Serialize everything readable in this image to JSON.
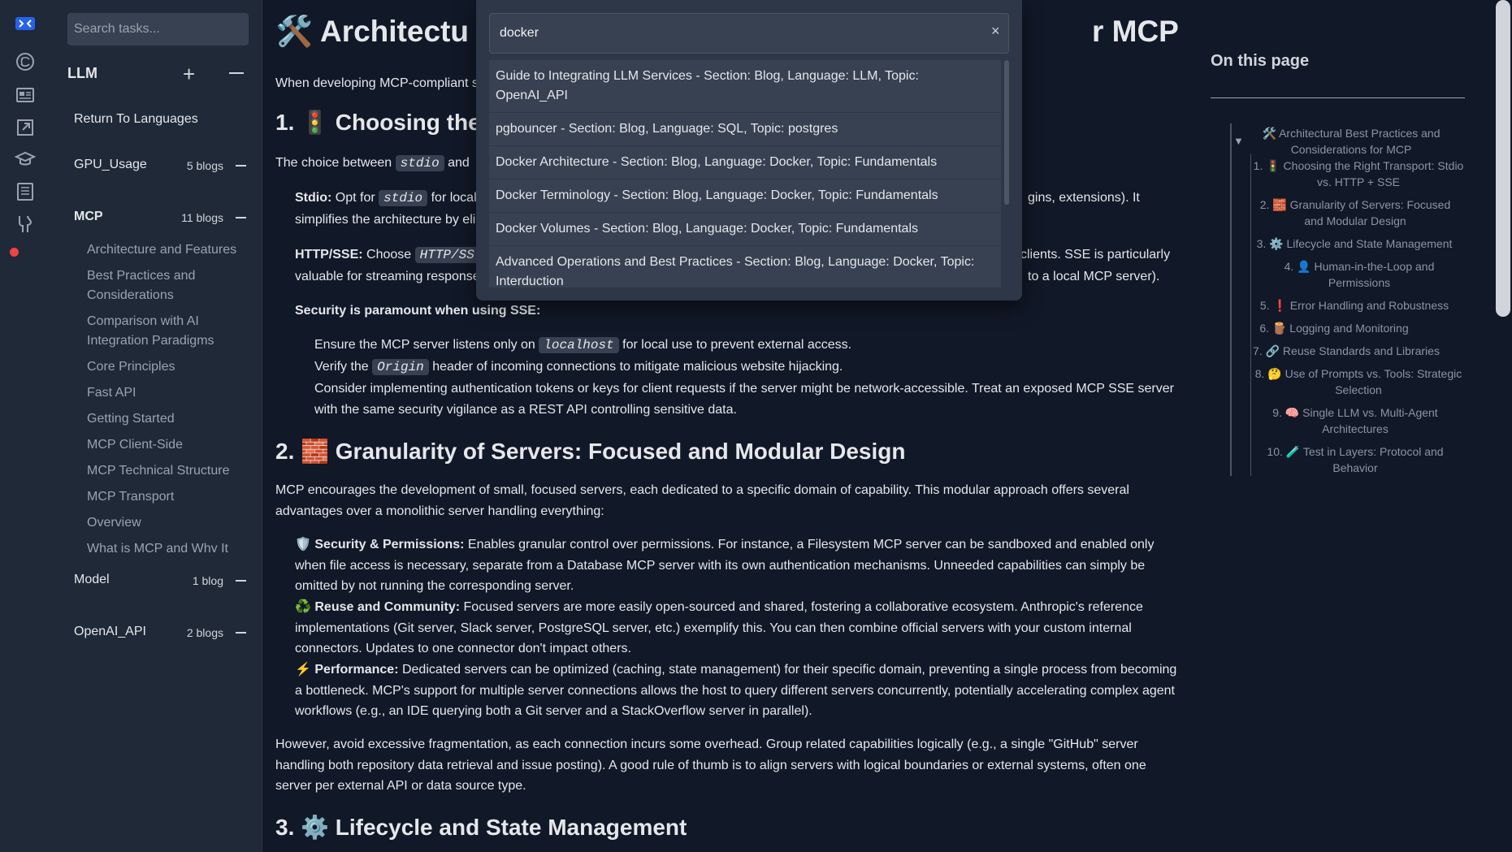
{
  "sidebar": {
    "search_placeholder": "Search tasks...",
    "title": "LLM",
    "return_label": "Return To Languages",
    "groups": [
      {
        "name": "GPU_Usage",
        "count": "5 blogs"
      },
      {
        "name": "MCP",
        "count": "11 blogs"
      },
      {
        "name": "Model",
        "count": "1 blog"
      },
      {
        "name": "OpenAI_API",
        "count": "2 blogs"
      }
    ],
    "mcp_items": [
      "Architecture and Features",
      "Best Practices and Considerations",
      "Comparison with AI Integration Paradigms",
      "Core Principles",
      "Fast API",
      "Getting Started",
      "MCP Client-Side",
      "MCP Technical Structure",
      "MCP Transport",
      "Overview",
      "What is MCP and Why It"
    ]
  },
  "search_modal": {
    "query": "docker",
    "clear": "×",
    "results": [
      "Guide to Integrating LLM Services - Section: Blog, Language: LLM, Topic: OpenAI_API",
      "pgbouncer - Section: Blog, Language: SQL, Topic: postgres",
      "Docker Architecture - Section: Blog, Language: Docker, Topic: Fundamentals",
      "Docker Terminology - Section: Blog, Language: Docker, Topic: Fundamentals",
      "Docker Volumes - Section: Blog, Language: Docker, Topic: Fundamentals",
      "Advanced Operations and Best Practices - Section: Blog, Language: Docker, Topic: Interduction",
      ""
    ]
  },
  "article": {
    "title_start": "🛠️ Architectu",
    "title_end": "r MCP",
    "intro": "When developing MCP-compliant s",
    "h2_1": "1. 🚦 Choosing the",
    "choice_a": "The choice between",
    "choice_code": "stdio",
    "choice_b": "and",
    "stdio_label": "Stdio:",
    "stdio_a": "Opt for",
    "stdio_code": "stdio",
    "stdio_b": "for local",
    "stdio_right": "gins, extensions). It",
    "stdio_line2": "simplifies the architecture by eli",
    "http_label": "HTTP/SSE:",
    "http_a": "Choose",
    "http_code": "HTTP/SS",
    "http_right": "l clients. SSE is particularly",
    "http_line2": "valuable for streaming response",
    "http_line2_right": "to a local MCP server).",
    "security_heading": "Security is paramount when using SSE:",
    "sec1_a": "Ensure the MCP server listens only on",
    "sec1_code": "localhost",
    "sec1_b": "for local use to prevent external access.",
    "sec2_a": "Verify the",
    "sec2_code": "Origin",
    "sec2_b": "header of incoming connections to mitigate malicious website hijacking.",
    "sec3": "Consider implementing authentication tokens or keys for client requests if the server might be network-accessible. Treat an exposed MCP SSE server with the same security vigilance as a REST API controlling sensitive data.",
    "h2_2": "2. 🧱 Granularity of Servers: Focused and Modular Design",
    "p2": "MCP encourages the development of small, focused servers, each dedicated to a specific domain of capability. This modular approach offers several advantages over a monolithic server handling everything:",
    "b1_label": "🛡️ Security & Permissions:",
    "b1_text": "Enables granular control over permissions. For instance, a Filesystem MCP server can be sandboxed and enabled only when file access is necessary, separate from a Database MCP server with its own authentication mechanisms. Unneeded capabilities can simply be omitted by not running the corresponding server.",
    "b2_label": "♻️ Reuse and Community:",
    "b2_text": "Focused servers are more easily open-sourced and shared, fostering a collaborative ecosystem. Anthropic's reference implementations (Git server, Slack server, PostgreSQL server, etc.) exemplify this. You can then combine official servers with your custom internal connectors. Updates to one connector don't impact others.",
    "b3_label": "⚡ Performance:",
    "b3_text": "Dedicated servers can be optimized (caching, state management) for their specific domain, preventing a single process from becoming a bottleneck. MCP's support for multiple server connections allows the host to query different servers concurrently, potentially accelerating complex agent workflows (e.g., an IDE querying both a Git server and a StackOverflow server in parallel).",
    "p3": "However, avoid excessive fragmentation, as each connection incurs some overhead. Group related capabilities logically (e.g., a single \"GitHub\" server handling both repository data retrieval and issue posting). A good rule of thumb is to align servers with logical boundaries or external systems, often one server per external API or data source type.",
    "h2_3": "3. ⚙️ Lifecycle and State Management"
  },
  "toc": {
    "title": "On this page",
    "caret": "▼",
    "items": [
      "🛠️ Architectural Best Practices and Considerations for MCP",
      "1. 🚦 Choosing the Right Transport: Stdio vs. HTTP + SSE",
      "2. 🧱 Granularity of Servers: Focused and Modular Design",
      "3. ⚙️ Lifecycle and State Management",
      "4. 👤 Human-in-the-Loop and Permissions",
      "5. ❗ Error Handling and Robustness",
      "6. 🪵 Logging and Monitoring",
      "7. 🔗 Reuse Standards and Libraries",
      "8. 🤔 Use of Prompts vs. Tools: Strategic Selection",
      "9. 🧠 Single LLM vs. Multi-Agent Architectures",
      "10. 🧪 Test in Layers: Protocol and Behavior"
    ]
  },
  "icons": {
    "rail": [
      "logo-icon",
      "openai-icon",
      "news-icon",
      "external-link-icon",
      "graduation-cap-icon",
      "document-icon",
      "tools-icon"
    ],
    "status_color": "#ef4444"
  }
}
